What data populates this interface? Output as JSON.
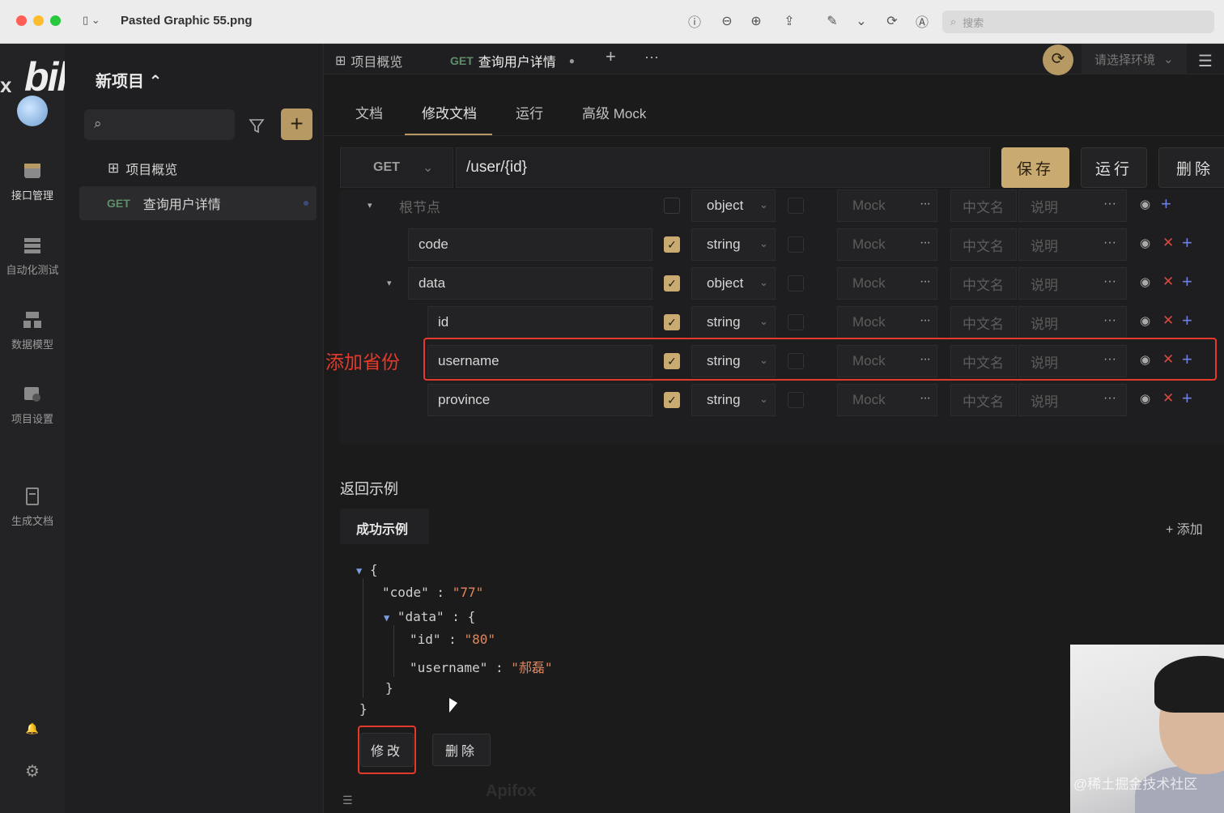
{
  "window": {
    "title": "Pasted Graphic 55.png",
    "search_placeholder": "搜索",
    "traffic_lights": [
      "#ff5f57",
      "#febc2e",
      "#28c840"
    ]
  },
  "brand": {
    "x_text": "x",
    "bili_text": "bilibili",
    "project_name": "新项目"
  },
  "rail": {
    "items": [
      {
        "label": "接口管理",
        "icon": "api-manage-icon"
      },
      {
        "label": "自动化测试",
        "icon": "auto-test-icon"
      },
      {
        "label": "数据模型",
        "icon": "data-model-icon"
      },
      {
        "label": "项目设置",
        "icon": "project-settings-icon"
      },
      {
        "label": "生成文档",
        "icon": "generate-doc-icon"
      }
    ]
  },
  "sidebar": {
    "items": [
      {
        "label": "项目概览"
      },
      {
        "method": "GET",
        "label": "查询用户详情"
      }
    ]
  },
  "tabs": [
    {
      "label": "项目概览"
    },
    {
      "method": "GET",
      "label": "查询用户详情"
    }
  ],
  "env_placeholder": "请选择环境",
  "subtabs": [
    "文档",
    "修改文档",
    "运行",
    "高级 Mock"
  ],
  "request": {
    "method": "GET",
    "path": "/user/{id}",
    "save": "保存",
    "run": "运行",
    "delete": "删除"
  },
  "schema": {
    "root_placeholder": "根节点",
    "mock_placeholder": "Mock",
    "cn_placeholder": "中文名",
    "desc_placeholder": "说明",
    "rows": [
      {
        "name": "code",
        "type": "string"
      },
      {
        "name": "data",
        "type": "object"
      },
      {
        "name": "id",
        "type": "string"
      },
      {
        "name": "username",
        "type": "string"
      },
      {
        "name": "province",
        "type": "string"
      }
    ],
    "root_type": "object"
  },
  "annotation": "添加省份",
  "response": {
    "title": "返回示例",
    "tab": "成功示例",
    "add": "添加",
    "json": {
      "code_key": "\"code\"",
      "code_val": "\"77\"",
      "data_key": "\"data\"",
      "id_key": "\"id\"",
      "id_val": "\"80\"",
      "username_key": "\"username\"",
      "username_val": "\"郝磊\""
    },
    "edit": "修改",
    "delete": "删除"
  },
  "watermarks": {
    "apifox": "Apifox",
    "juejin": "@稀土掘金技术社区"
  }
}
